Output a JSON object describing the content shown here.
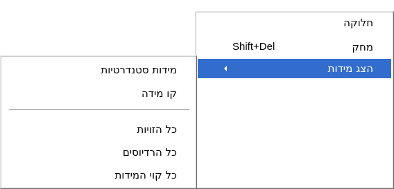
{
  "main_menu": {
    "items": [
      {
        "label": "חלוקה",
        "shortcut": ""
      },
      {
        "label": "מחק",
        "shortcut": "Shift+Del"
      },
      {
        "label": "הצג מידות",
        "shortcut": "",
        "has_submenu": true,
        "highlighted": true
      }
    ]
  },
  "sub_menu": {
    "items": [
      {
        "label": "מידות סטנדרטיות"
      },
      {
        "label": "קו מידה"
      },
      {
        "label": "כל הזויות"
      },
      {
        "label": "כל הרדיוסים"
      },
      {
        "label": "כל קוי המידות"
      }
    ]
  },
  "colors": {
    "highlight": "#326ccd",
    "menu_bg": "#ffffff"
  }
}
